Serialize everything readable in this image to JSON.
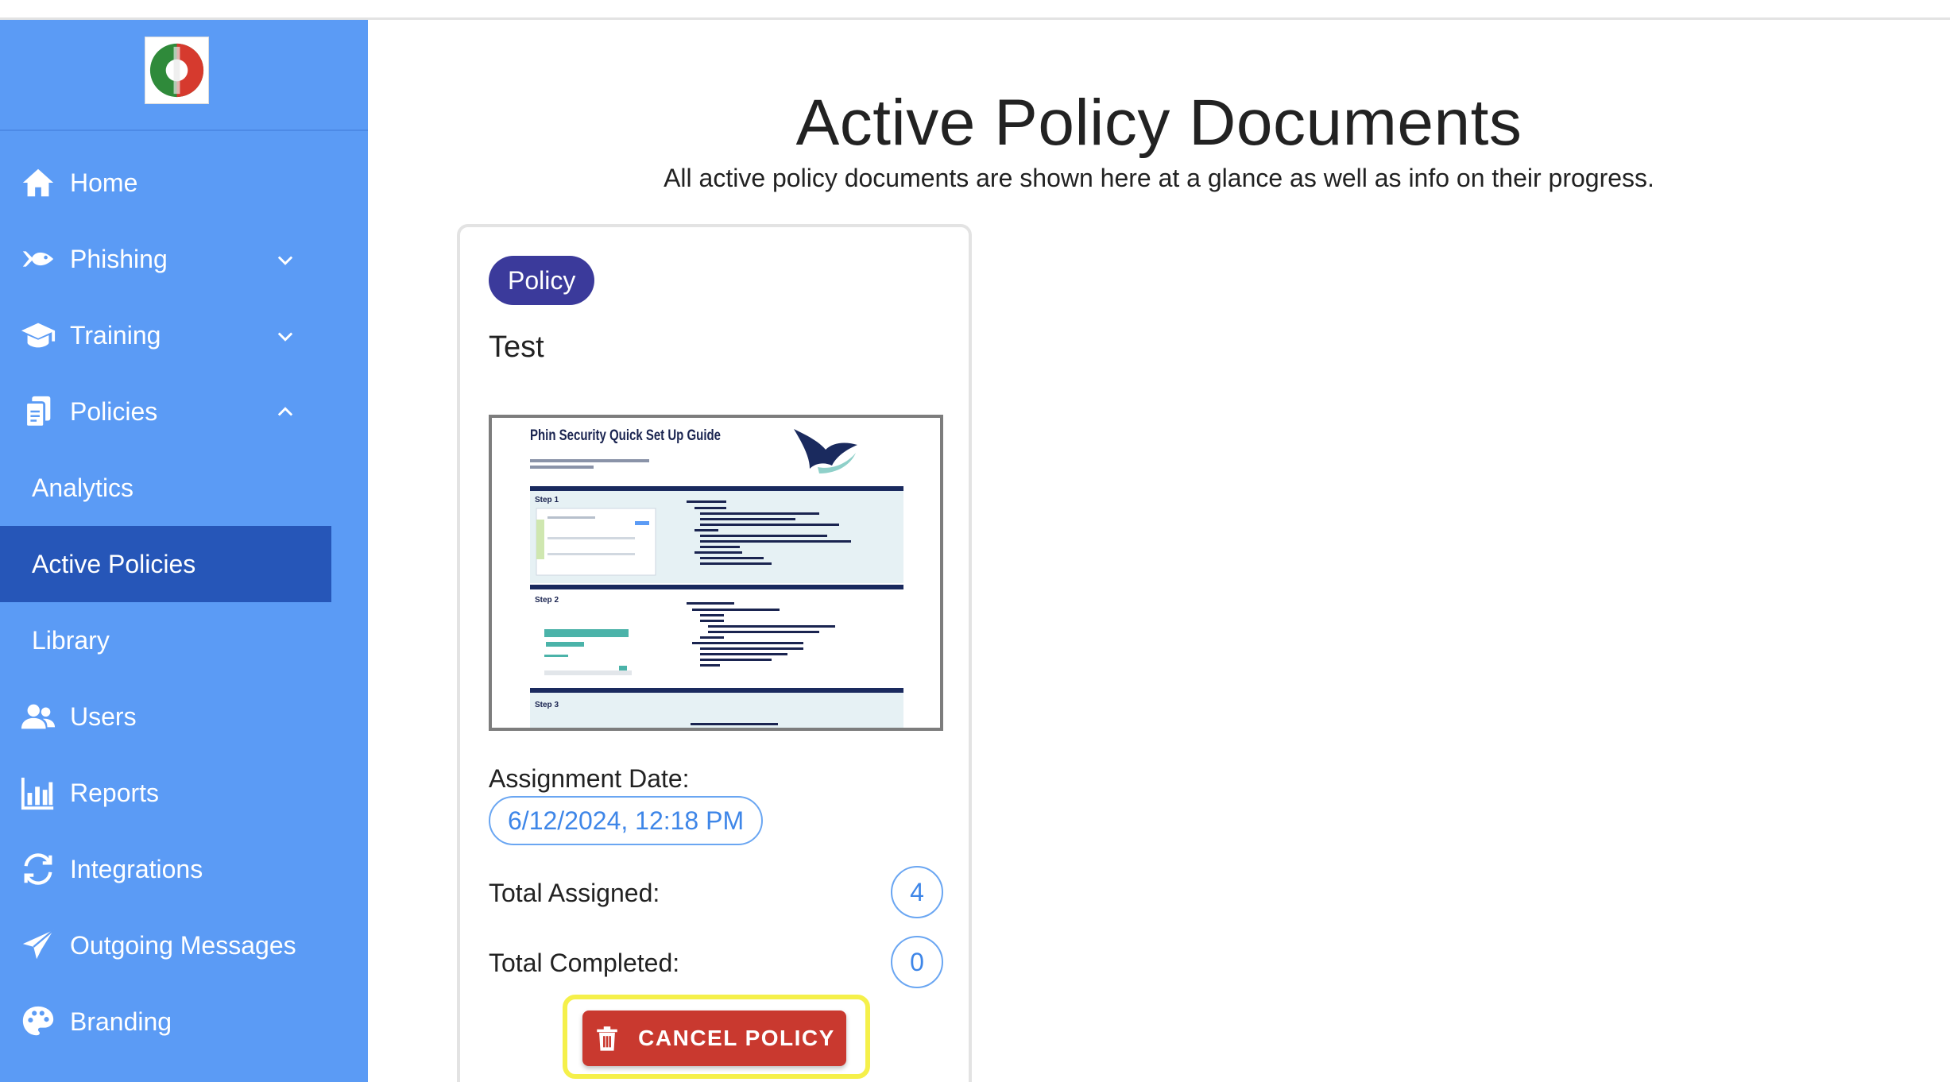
{
  "page": {
    "title": "Active Policy Documents",
    "subtitle": "All active policy documents are shown here at a glance as well as info on their progress."
  },
  "sidebar": {
    "logo_name": "pizza-logo",
    "items": [
      {
        "label": "Home",
        "icon": "home-icon"
      },
      {
        "label": "Phishing",
        "icon": "fish-icon",
        "expandable": true,
        "expanded": false
      },
      {
        "label": "Training",
        "icon": "graduation-cap-icon",
        "expandable": true,
        "expanded": false
      },
      {
        "label": "Policies",
        "icon": "documents-icon",
        "expandable": true,
        "expanded": true
      },
      {
        "label": "Users",
        "icon": "users-icon"
      },
      {
        "label": "Reports",
        "icon": "bar-chart-icon"
      },
      {
        "label": "Integrations",
        "icon": "sync-icon"
      },
      {
        "label": "Outgoing Messages",
        "icon": "paper-plane-icon"
      },
      {
        "label": "Branding",
        "icon": "palette-icon"
      }
    ],
    "policies_sub": [
      {
        "label": "Analytics",
        "active": false
      },
      {
        "label": "Active Policies",
        "active": true
      },
      {
        "label": "Library",
        "active": false
      }
    ]
  },
  "card": {
    "badge": "Policy",
    "name": "Test",
    "preview": {
      "heading": "Phin Security Quick Set Up Guide",
      "step1": "Step 1",
      "step2": "Step 2",
      "step3": "Step 3"
    },
    "assignment_date_label": "Assignment Date:",
    "assignment_date": "6/12/2024, 12:18 PM",
    "total_assigned_label": "Total Assigned:",
    "total_assigned": "4",
    "total_completed_label": "Total Completed:",
    "total_completed": "0",
    "cancel_label": "CANCEL POLICY"
  },
  "colors": {
    "sidebar": "#5b9bf5",
    "active_item": "#2656b8",
    "badge": "#3b3a9b",
    "cancel": "#c9392f",
    "highlight": "#f5f04a",
    "pill": "#3e86e8"
  }
}
